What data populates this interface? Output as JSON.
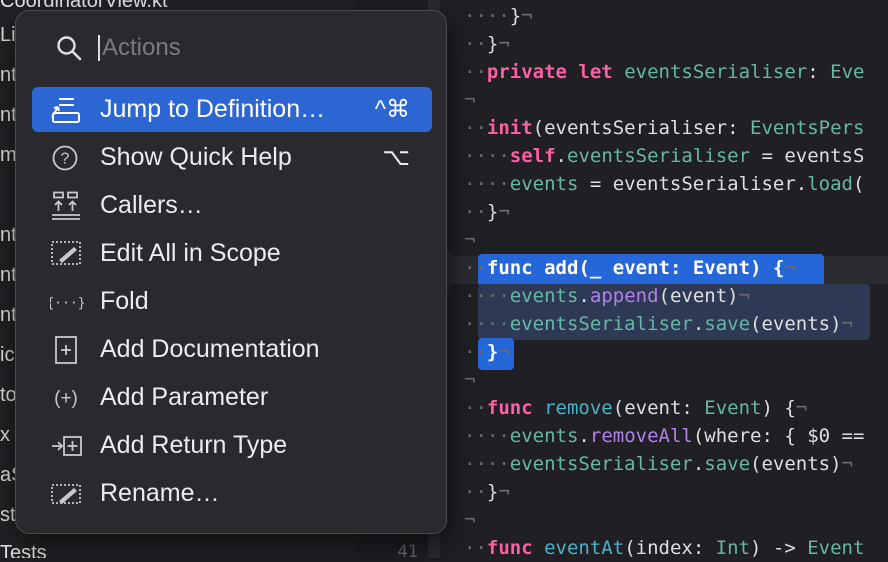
{
  "navigator": {
    "lines": [
      "CoordinatorView.kt",
      "Li",
      "nt",
      "nt",
      "mp",
      "",
      "nt",
      "nt",
      "nt",
      "ic",
      "to",
      "x",
      "aS",
      "st",
      "Tests"
    ]
  },
  "gutter": {
    "visible_line_number": "41"
  },
  "popover": {
    "search_placeholder": "Actions",
    "items": [
      {
        "label": "Jump to Definition…",
        "shortcut": "^⌘",
        "icon": "jump-to-definition-icon",
        "active": true
      },
      {
        "label": "Show Quick Help",
        "shortcut": "⌥",
        "icon": "help-circle-icon"
      },
      {
        "label": "Callers…",
        "shortcut": "",
        "icon": "callers-icon"
      },
      {
        "label": "Edit All in Scope",
        "shortcut": "",
        "icon": "edit-scope-icon"
      },
      {
        "label": "Fold",
        "shortcut": "",
        "icon": "fold-icon"
      },
      {
        "label": "Add Documentation",
        "shortcut": "",
        "icon": "add-documentation-icon"
      },
      {
        "label": "Add Parameter",
        "shortcut": "",
        "icon": "add-parameter-icon"
      },
      {
        "label": "Add Return Type",
        "shortcut": "",
        "icon": "add-return-type-icon"
      },
      {
        "label": "Rename…",
        "shortcut": "",
        "icon": "rename-icon"
      }
    ]
  },
  "code": {
    "l1": {
      "ws": "····",
      "t1": "}",
      "nl": "¬"
    },
    "l2": {
      "t1": "}",
      "nl": "¬"
    },
    "l3": {
      "kw1": "private",
      "kw2": "let",
      "fn": "eventsSerialiser",
      "p": ": ",
      "ty": "Eve"
    },
    "l4": {
      "nl": "¬"
    },
    "l5": {
      "kw": "init",
      "p1": "(eventsSerialiser: ",
      "ty": "EventsPers"
    },
    "l6": {
      "ws": "··",
      "kw": "self",
      "p1": ".",
      "fn": "eventsSerialiser",
      "p2": " = eventsS"
    },
    "l7": {
      "ws": "··",
      "fn": "events",
      "p1": " = eventsSerialiser.",
      "call": "load",
      "p2": "("
    },
    "l8": {
      "t1": "}",
      "nl": "¬"
    },
    "l9": {
      "nl": "¬"
    },
    "l10": {
      "kw": "func",
      "fn": "add",
      "p1": "(_ event: ",
      "ty": "Event",
      "p2": ") {",
      "nl": "¬"
    },
    "l11": {
      "ws": "··",
      "fn": "events",
      "p1": ".",
      "call": "append",
      "p2": "(event)",
      "nl": "¬"
    },
    "l12": {
      "ws": "··",
      "fn": "eventsSerialiser",
      "p1": ".",
      "call": "save",
      "p2": "(events)",
      "nl": "¬"
    },
    "l13": {
      "t1": "}",
      "nl": "¬"
    },
    "l14": {
      "nl": "¬"
    },
    "l15": {
      "kw": "func",
      "fn": "remove",
      "p1": "(event: ",
      "ty": "Event",
      "p2": ") {",
      "nl": "¬"
    },
    "l16": {
      "ws": "··",
      "fn": "events",
      "p1": ".",
      "call": "removeAll",
      "p2": "(where: { $0 =="
    },
    "l17": {
      "ws": "··",
      "fn": "eventsSerialiser",
      "p1": ".",
      "call": "save",
      "p2": "(events)",
      "nl": "¬"
    },
    "l18": {
      "t1": "}",
      "nl": "¬"
    },
    "l19": {
      "nl": "¬"
    },
    "l20": {
      "kw": "func",
      "fn": "eventAt",
      "p1": "(index: ",
      "ty": "Int",
      "p2": ") -> ",
      "ty2": "Event"
    }
  }
}
